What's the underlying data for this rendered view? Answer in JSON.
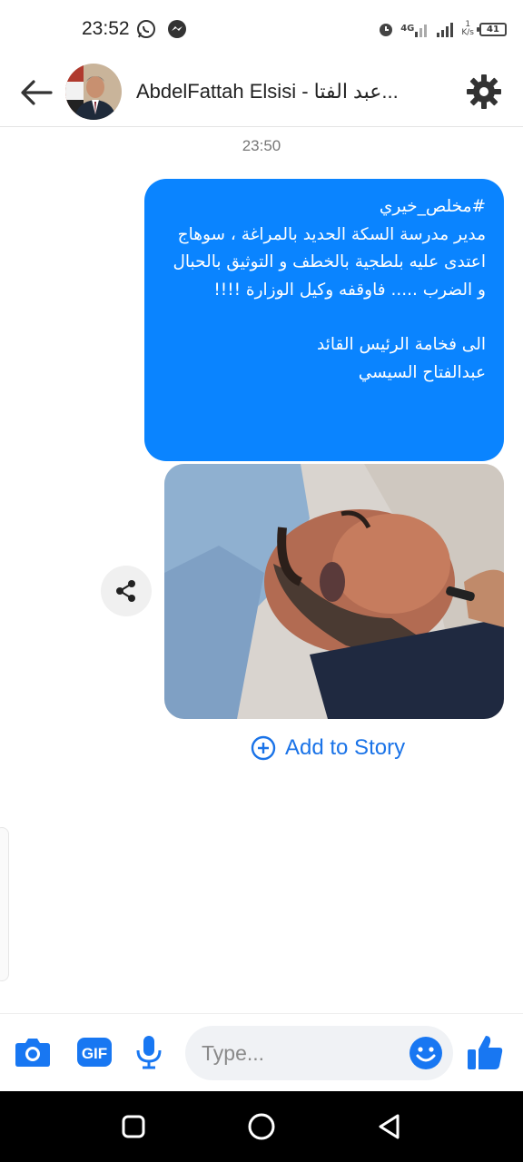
{
  "status_bar": {
    "time": "23:52",
    "network_type": "4G",
    "speed_value": "1",
    "speed_unit": "K/s",
    "battery": "41"
  },
  "header": {
    "contact_name": "AbdelFattah Elsisi - عبد الفتا...",
    "back_icon": "arrow-left-icon",
    "settings_icon": "gear-icon"
  },
  "conversation": {
    "timestamp": "23:50",
    "message": {
      "line1": "#مخلص_خيري",
      "body": "مدير مدرسة السكة الحديد بالمراغة ، سوهاج اعتدى عليه بلطجية بالخطف و التوثيق بالحبال و الضرب ..... فاوقفه وكيل الوزارة !!!!",
      "closing": "الى فخامة الرئيس القائد\nعبدالفتاح السيسي"
    },
    "share_icon": "share-icon",
    "add_to_story": "Add to Story"
  },
  "composer": {
    "placeholder": "Type...",
    "camera_icon": "camera-icon",
    "gif_label": "GIF",
    "mic_icon": "microphone-icon",
    "emoji_icon": "emoji-icon",
    "like_icon": "thumbs-up-icon"
  },
  "colors": {
    "accent": "#0a84ff",
    "link": "#1a73e8",
    "icon_blue": "#1877f2"
  }
}
